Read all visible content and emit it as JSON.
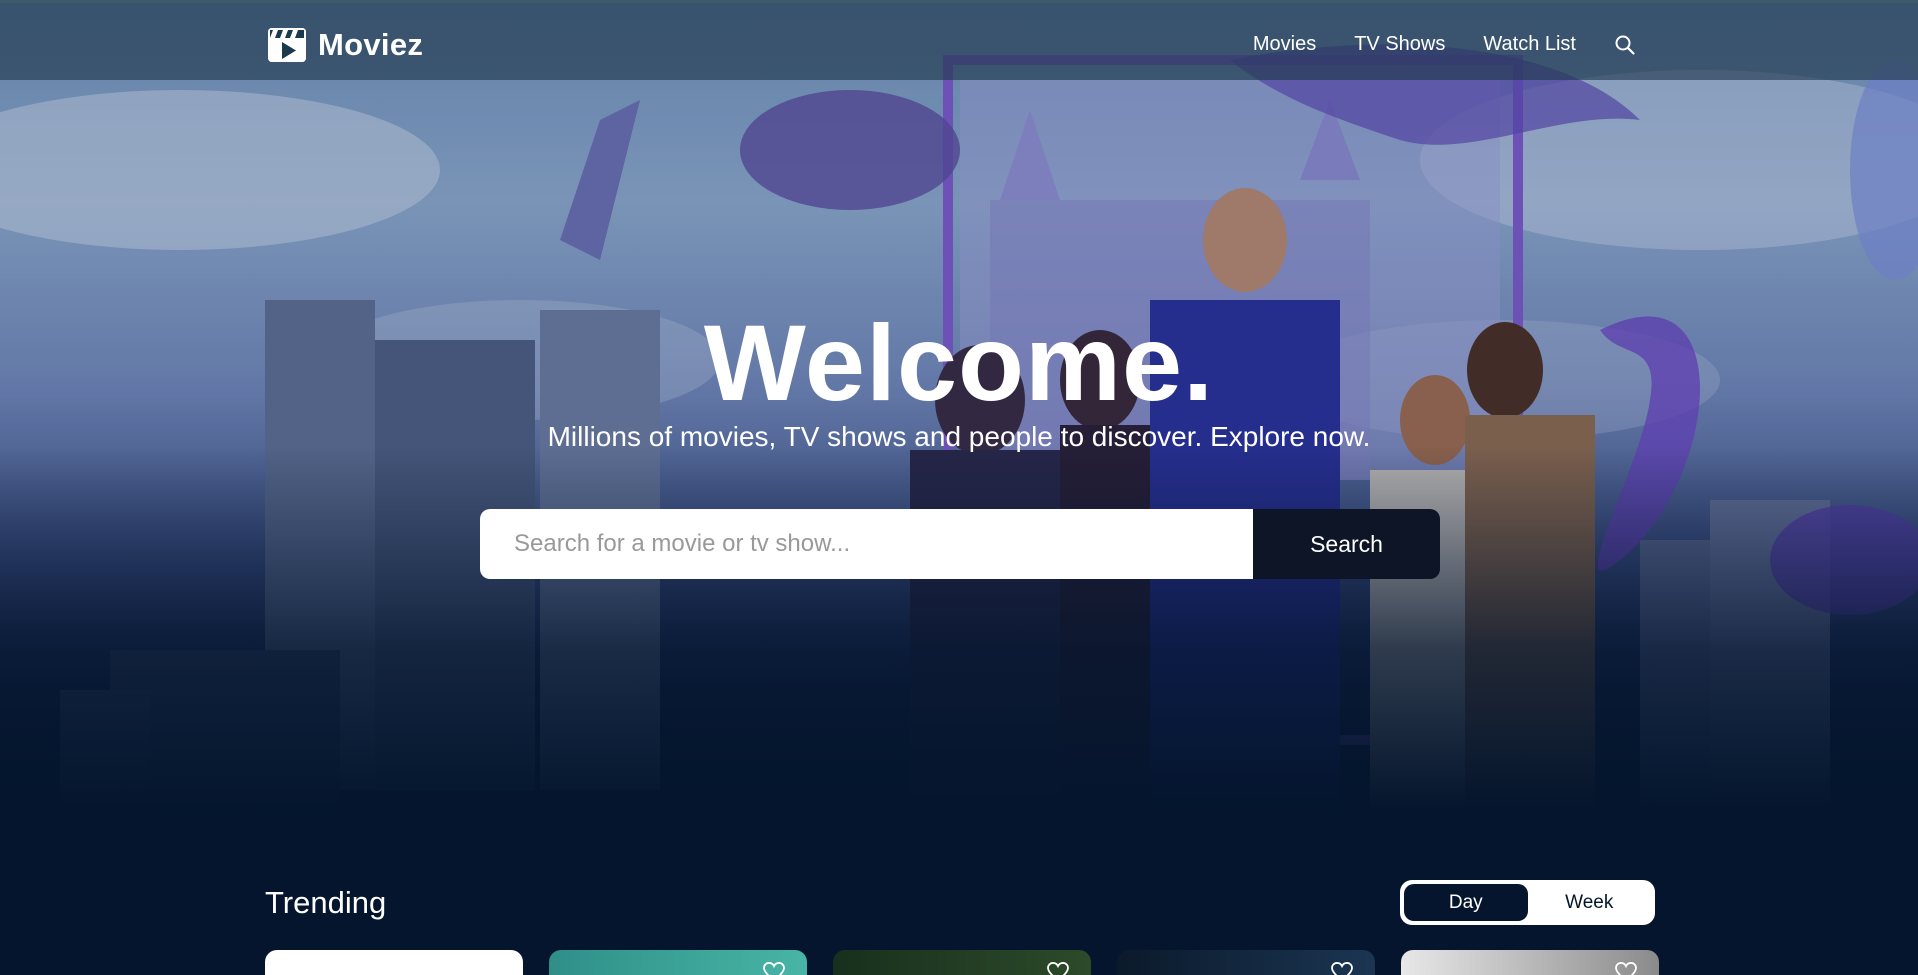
{
  "header": {
    "logo_text": "Moviez",
    "nav": [
      "Movies",
      "TV Shows",
      "Watch List"
    ],
    "search_icon": "search-icon"
  },
  "hero": {
    "title": "Welcome.",
    "subtitle": "Millions of movies, TV shows and people to discover. Explore now.",
    "search_placeholder": "Search for a movie or tv show...",
    "search_button": "Search"
  },
  "trending": {
    "title": "Trending",
    "toggle": [
      "Day",
      "Week"
    ],
    "active_toggle": "Day",
    "card_colors": [
      "#ffffff",
      "#3aa39a",
      "#1f3a25",
      "#0f2030",
      "#d9d9d9"
    ]
  },
  "colors": {
    "background": "#04152d",
    "search_button": "#0d1526",
    "header": "#1e374b"
  }
}
